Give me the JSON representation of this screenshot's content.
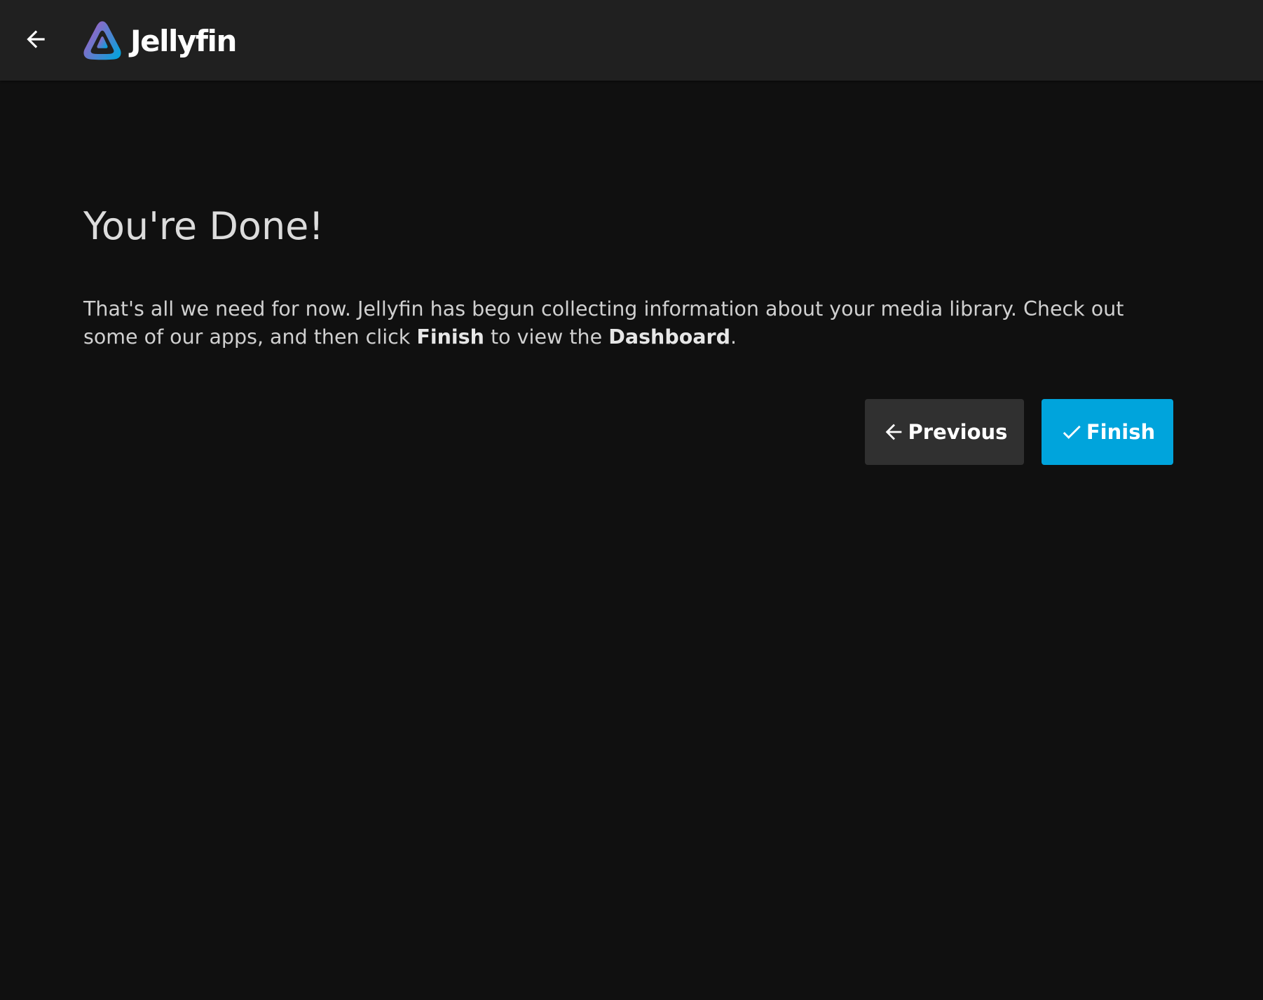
{
  "header": {
    "back_icon": "arrow-left-icon",
    "logo_icon": "jellyfin-logo-icon",
    "brand_name": "Jellyfin"
  },
  "main": {
    "title": "You're Done!",
    "intro_part1": "That's all we need for now. Jellyfin has begun collecting information about your media library. Check out some of our apps, and then click ",
    "intro_bold1": "Finish",
    "intro_part2": " to view the ",
    "intro_bold2": "Dashboard",
    "intro_part3": "."
  },
  "buttons": {
    "previous_label": "Previous",
    "previous_icon": "arrow-left-icon",
    "finish_label": "Finish",
    "finish_icon": "check-icon"
  },
  "colors": {
    "background": "#101010",
    "header": "#202020",
    "accent": "#00a4dc",
    "secondary_button": "#303030"
  }
}
